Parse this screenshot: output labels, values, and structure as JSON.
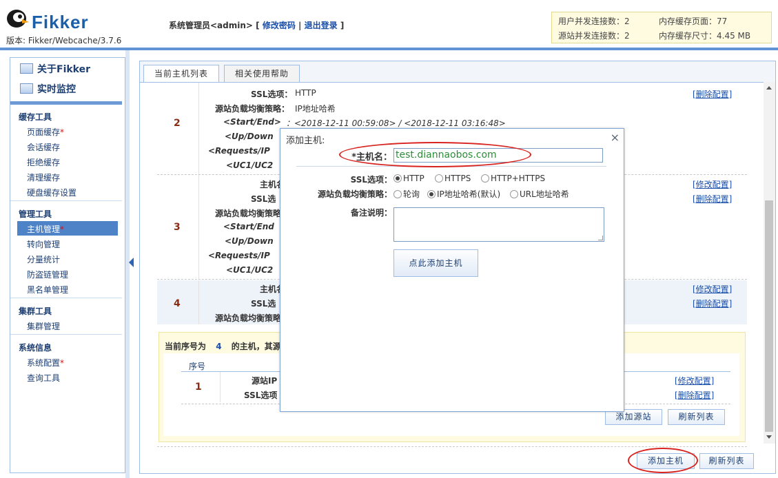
{
  "header": {
    "logo_text": "Fikker",
    "version": "版本: Fikker/Webcache/3.7.6",
    "admin_label": "系统管理员<admin>",
    "bracket_open": "[",
    "change_password": "修改密码",
    "separator": "|",
    "logout": "退出登录",
    "bracket_close": "]",
    "stats": {
      "user_conn": "用户并发连接数：2",
      "origin_conn": "源站并发连接数：2",
      "cache_pages": "内存缓存页面：77",
      "cache_size": "内存缓存尺寸：4.45 MB"
    }
  },
  "sidebar": {
    "about": "关于Fikker",
    "monitor": "实时监控",
    "groups": {
      "cache_tools": "缓存工具",
      "manage_tools": "管理工具",
      "cluster_tools": "集群工具",
      "system_info": "系统信息"
    },
    "items": {
      "page_cache": "页面缓存",
      "session_cache": "会话缓存",
      "reject_cache": "拒绝缓存",
      "clear_cache": "清理缓存",
      "disk_cache_settings": "硬盘缓存设置",
      "host_manage": "主机管理",
      "redirect_manage": "转向管理",
      "traffic_stats": "分量统计",
      "hotlink_manage": "防盗链管理",
      "blacklist_manage": "黑名单管理",
      "cluster_manage": "集群管理",
      "system_config": "系统配置",
      "query_tools": "查询工具"
    },
    "star": "*"
  },
  "tabs": {
    "host_list": "当前主机列表",
    "help": "相关使用帮助"
  },
  "list": {
    "row2": {
      "index": "2",
      "ssl_label": "SSL选项：",
      "ssl_value": "HTTP",
      "lb_label": "源站负载均衡策略：",
      "lb_value": "IP地址哈希",
      "start_end_label": "<Start/End>",
      "start_end_value": "：<2018-12-11 00:59:08> / <2018-12-11 03:16:48>",
      "up_down_label": "<Up/Down",
      "requests_label": "<Requests/IP",
      "uc_label": "<UC1/UC2",
      "delete": "[删除配置]"
    },
    "row3": {
      "index": "3",
      "host_label": "主机名",
      "ssl_label": "SSL选",
      "lb_label": "源站负载均衡策略",
      "start_end_label": "<Start/End",
      "up_down_label": "<Up/Down",
      "requests_label": "<Requests/IP",
      "uc_label": "<UC1/UC2",
      "modify": "[修改配置]",
      "delete": "[删除配置]"
    },
    "row4": {
      "index": "4",
      "host_label": "主机名",
      "ssl_label": "SSL选",
      "lb_label": "源站负载均衡策略",
      "modify": "[修改配置]",
      "delete": "[删除配置]"
    },
    "notice_prefix": "当前序号为",
    "notice_number": "4",
    "notice_suffix": "的主机，其源",
    "origin_table": {
      "col_index": "序号",
      "index": "1",
      "origin_ip_label": "源站IP",
      "ssl_label": "SSL选项",
      "modify": "[修改配置]",
      "delete": "[删除配置]"
    },
    "add_origin": "添加源站",
    "refresh_list": "刷新列表",
    "add_host": "添加主机",
    "refresh_list_bottom": "刷新列表"
  },
  "dialog": {
    "title": "添加主机:",
    "close": "×",
    "hostname_label": "*主机名：",
    "hostname_value": "test.diannaobos.com",
    "ssl_label": "SSL选项：",
    "ssl_options": [
      "HTTP",
      "HTTPS",
      "HTTP+HTTPS"
    ],
    "lb_label": "源站负载均衡策略：",
    "lb_options": [
      "轮询",
      "IP地址哈希(默认)",
      "URL地址哈希"
    ],
    "note_label": "备注说明：",
    "submit": "点此添加主机"
  }
}
